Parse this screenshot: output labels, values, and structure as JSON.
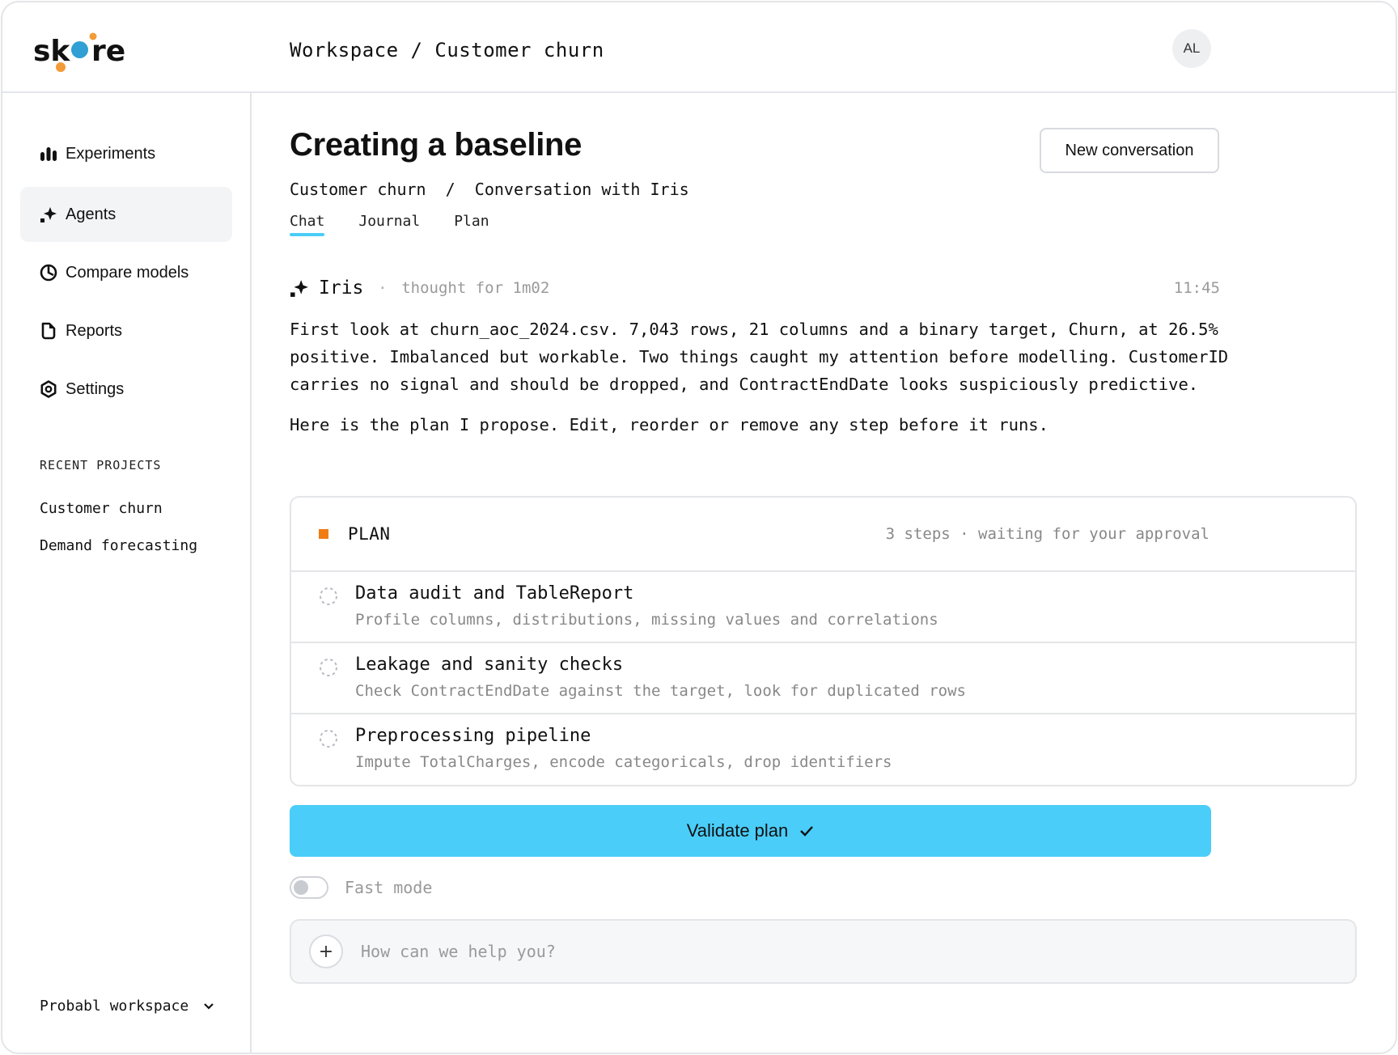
{
  "app": {
    "logo_text": "skore"
  },
  "header": {
    "breadcrumb": "Workspace / Customer churn",
    "avatar_initials": "AL"
  },
  "sidebar": {
    "nav": [
      {
        "label": "Experiments",
        "icon": "bar-chart-icon"
      },
      {
        "label": "Agents",
        "icon": "sparkle-icon",
        "active": true
      },
      {
        "label": "Compare models",
        "icon": "pie-chart-icon"
      },
      {
        "label": "Reports",
        "icon": "document-icon"
      },
      {
        "label": "Settings",
        "icon": "settings-hex-icon"
      }
    ],
    "recent_label": "RECENT PROJECTS",
    "recent": [
      "Customer churn",
      "Demand forecasting"
    ],
    "workspace": "Probabl workspace"
  },
  "main": {
    "title": "Creating a baseline",
    "new_conversation": "New conversation",
    "breadcrumb": "Customer churn  /  Conversation with Iris",
    "tabs": [
      {
        "label": "Chat",
        "active": true
      },
      {
        "label": "Journal"
      },
      {
        "label": "Plan"
      }
    ],
    "message": {
      "agent": "Iris",
      "separator": "·",
      "thought": "thought for 1m02",
      "time": "11:45",
      "paragraph1": "First look at churn_aoc_2024.csv. 7,043 rows, 21 columns and a binary target, Churn, at 26.5% positive. Imbalanced but workable. Two things caught my attention before modelling. CustomerID carries no signal and should be dropped, and ContractEndDate looks suspiciously predictive.",
      "paragraph2": "Here is the plan I propose. Edit, reorder or remove any step before it runs."
    },
    "plan": {
      "title": "PLAN",
      "status": "3 steps · waiting for your approval",
      "steps": [
        {
          "title": "Data audit and TableReport",
          "desc": "Profile columns, distributions, missing values and correlations"
        },
        {
          "title": "Leakage and sanity checks",
          "desc": "Check ContractEndDate against the target, look for duplicated rows"
        },
        {
          "title": "Preprocessing pipeline",
          "desc": "Impute TotalCharges, encode categoricals, drop identifiers"
        }
      ]
    },
    "validate_label": "Validate plan",
    "fast_mode_label": "Fast mode",
    "fast_mode_on": false,
    "input_placeholder": "How can we help you?"
  },
  "colors": {
    "accent": "#4acdf9",
    "plan_marker": "#f07d14",
    "logo_blue": "#2f9fd4",
    "logo_orange": "#f29b38"
  }
}
